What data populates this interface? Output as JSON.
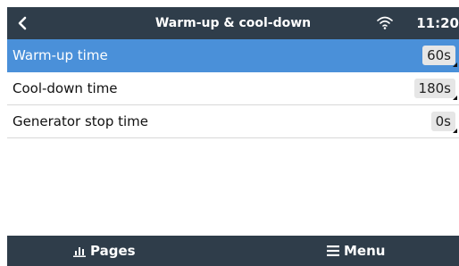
{
  "header": {
    "title": "Warm-up & cool-down",
    "time": "11:20"
  },
  "list": {
    "items": [
      {
        "label": "Warm-up time",
        "value": "60s"
      },
      {
        "label": "Cool-down time",
        "value": "180s"
      },
      {
        "label": "Generator stop time",
        "value": "0s"
      }
    ]
  },
  "footer": {
    "pages_label": "Pages",
    "menu_label": "Menu"
  },
  "icons": {
    "back": "chevron-left-icon",
    "wifi": "wifi-icon",
    "pages": "bar-chart-icon",
    "menu": "hamburger-menu-icon"
  },
  "colors": {
    "header_bg": "#2f3d4a",
    "selected_bg": "#4a90d9"
  }
}
